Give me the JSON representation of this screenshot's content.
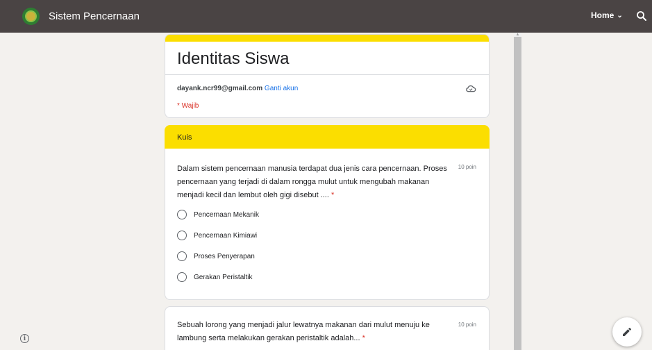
{
  "topbar": {
    "site_title": "Sistem Pencernaan",
    "home_label": "Home",
    "icons": {
      "logo": "school-logo",
      "chevron": "chevron-down-icon",
      "search": "search-icon"
    }
  },
  "form": {
    "title": "Identitas Siswa",
    "account": {
      "email": "dayank.ncr99@gmail.com",
      "switch_label": "Ganti akun"
    },
    "required_note": "* Wajib",
    "accent_color": "#fbde00"
  },
  "section": {
    "label": "Kuis"
  },
  "questions": [
    {
      "text": "Dalam sistem pencernaan manusia terdapat dua jenis cara pencernaan. Proses pencernaan yang terjadi di dalam rongga mulut untuk mengubah makanan menjadi kecil dan lembut oleh gigi disebut .... ",
      "required_mark": "*",
      "points": "10 poin",
      "options": [
        "Pencernaan Mekanik",
        "Pencernaan Kimiawi",
        "Proses Penyerapan",
        "Gerakan Peristaltik"
      ]
    },
    {
      "text": "Sebuah lorong yang menjadi jalur lewatnya makanan dari mulut menuju ke lambung serta melakukan gerakan peristaltik adalah... ",
      "required_mark": "*",
      "points": "10 poin"
    }
  ]
}
